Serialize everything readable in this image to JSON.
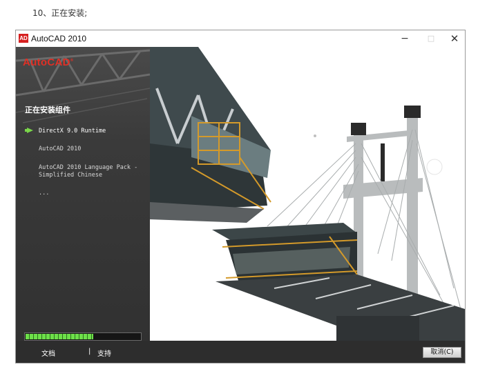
{
  "caption": "10、正在安装;",
  "window": {
    "title": "AutoCAD 2010",
    "icon_label": "AD",
    "minimize_glyph": "−",
    "maximize_glyph": "□",
    "close_glyph": "✕"
  },
  "left_panel": {
    "brand": "AutoCAD",
    "brand_mark": "®",
    "section_title": "正在安装组件",
    "steps": [
      {
        "line1": "DirectX 9.0 Runtime",
        "line2": "",
        "current": true
      },
      {
        "line1": "AutoCAD 2010",
        "line2": "",
        "current": false
      },
      {
        "line1": "AutoCAD 2010 Language Pack -",
        "line2": "Simplified Chinese",
        "current": false
      },
      {
        "line1": "...",
        "line2": "",
        "current": false
      }
    ]
  },
  "progress": {
    "fraction": 0.59
  },
  "footer": {
    "docs_link": "文档",
    "separator": "|",
    "support_link": "支持",
    "cancel_button": "取消(C)"
  },
  "colors": {
    "brand_red": "#e03026",
    "progress_green": "#6ee04a",
    "panel_dark": "#3a3a3a",
    "footer_dark": "#2d2d2d"
  }
}
